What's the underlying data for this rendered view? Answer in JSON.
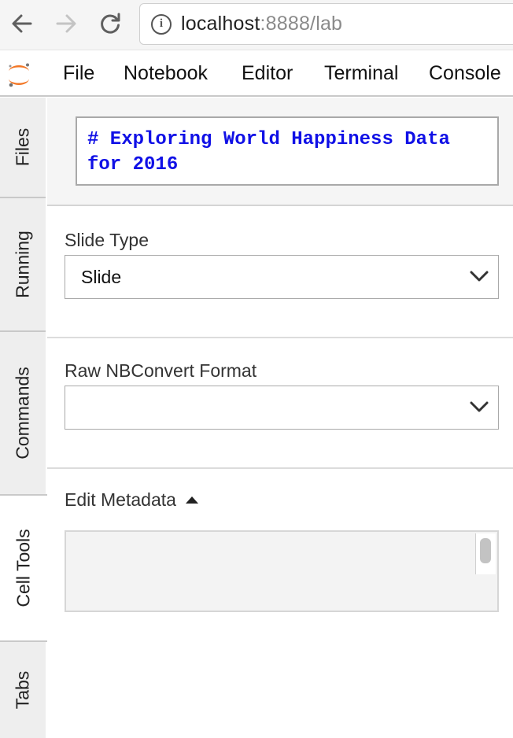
{
  "browser": {
    "url_host": "localhost",
    "url_rest": ":8888/lab",
    "info_icon": "i"
  },
  "menu": {
    "items": [
      "File",
      "Notebook",
      "Editor",
      "Terminal",
      "Console"
    ]
  },
  "sidebar": {
    "tabs": [
      "Files",
      "Running",
      "Commands",
      "Cell Tools",
      "Tabs"
    ],
    "active": "Cell Tools"
  },
  "cell_preview": {
    "text": "# Exploring World Happiness Data\nfor 2016"
  },
  "cell_tools": {
    "slide_type_label": "Slide Type",
    "slide_type_value": "Slide",
    "raw_format_label": "Raw NBConvert Format",
    "raw_format_value": "",
    "edit_metadata_label": "Edit Metadata",
    "metadata_value": ""
  },
  "colors": {
    "jupyter_orange": "#f37726",
    "markdown_blue": "#1010e6"
  }
}
